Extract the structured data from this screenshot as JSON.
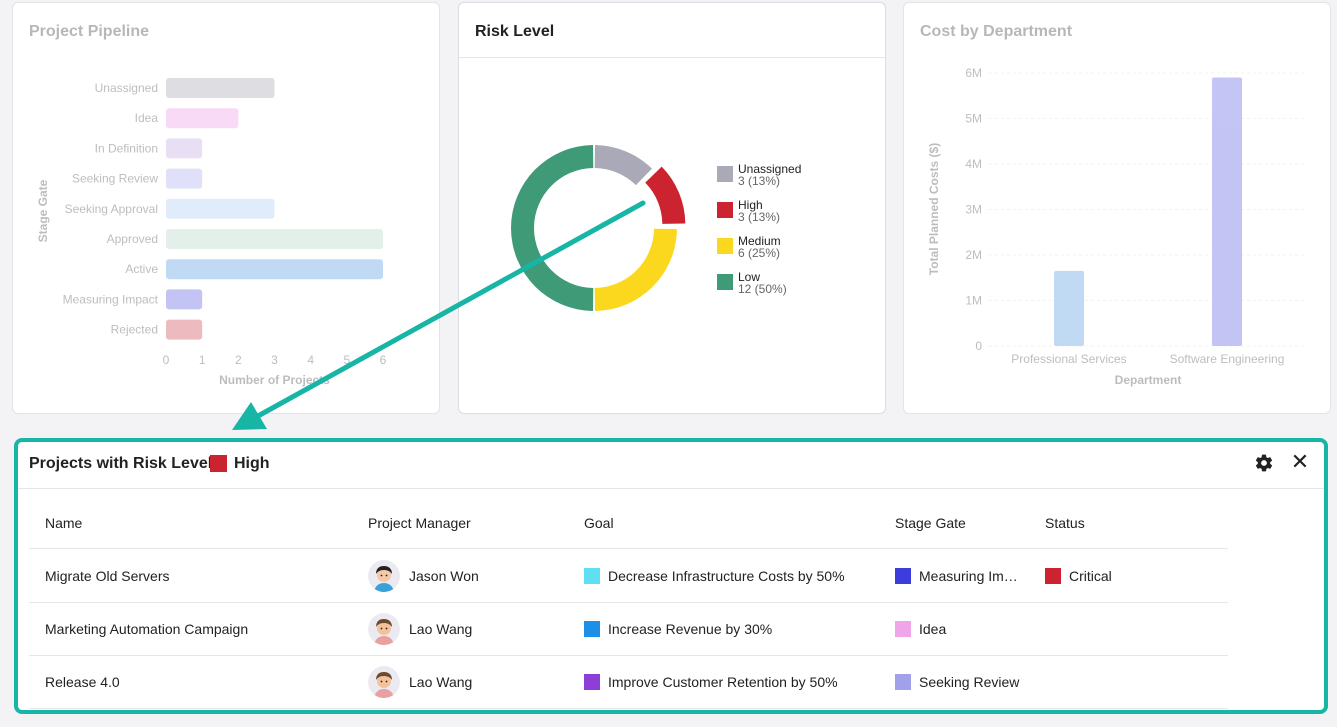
{
  "pipeline": {
    "title": "Project Pipeline",
    "chart_data": {
      "type": "bar",
      "orientation": "horizontal",
      "categories": [
        "Unassigned",
        "Idea",
        "In Definition",
        "Seeking Review",
        "Seeking Approval",
        "Approved",
        "Active",
        "Measuring Impact",
        "Rejected"
      ],
      "values": [
        3,
        2,
        1,
        1,
        3,
        6,
        6,
        1,
        1
      ],
      "colors": [
        "#9a9aa6",
        "#e989e3",
        "#b99ee3",
        "#a1a1ea",
        "#a4c6f0",
        "#a9d2c0",
        "#3d8fe0",
        "#4a4ae0",
        "#c62b3c"
      ],
      "xlabel": "Number of Projects",
      "ylabel": "Stage Gate",
      "xticks": [
        "0",
        "1",
        "2",
        "3",
        "4",
        "5",
        "6"
      ],
      "xlim": [
        0,
        6
      ]
    }
  },
  "risk": {
    "title": "Risk Level",
    "chart_data": {
      "type": "pie",
      "style": "donut",
      "legend_position": "right",
      "slices": [
        {
          "name": "Unassigned",
          "value": 3,
          "label": "3 (13%)",
          "color": "#a9a9b7"
        },
        {
          "name": "High",
          "value": 3,
          "label": "3 (13%)",
          "color": "#cc2330"
        },
        {
          "name": "Medium",
          "value": 6,
          "label": "6 (25%)",
          "color": "#fbd81e"
        },
        {
          "name": "Low",
          "value": 12,
          "label": "12 (50%)",
          "color": "#3f9a77"
        }
      ],
      "highlighted": "High"
    }
  },
  "cost": {
    "title": "Cost by Department",
    "chart_data": {
      "type": "bar",
      "categories": [
        "Professional Services",
        "Software Engineering"
      ],
      "values": [
        1650000,
        5900000
      ],
      "colors": [
        "#3d8fe0",
        "#4a4ae0"
      ],
      "xlabel": "Department",
      "ylabel": "Total Planned Costs ($)",
      "yticks": [
        "0",
        "1M",
        "2M",
        "3M",
        "4M",
        "5M",
        "6M"
      ],
      "ylim": [
        0,
        6000000
      ]
    }
  },
  "projects_panel": {
    "title": "Projects with Risk Level:",
    "level": "High",
    "level_color": "#cc2330",
    "gear_icon": "gear-icon",
    "close_label": "✕",
    "columns": [
      "Name",
      "Project Manager",
      "Goal",
      "Stage Gate",
      "Status"
    ],
    "rows": [
      {
        "name": "Migrate Old Servers",
        "manager": "Jason Won",
        "goal": "Decrease Infrastructure Costs by 50%",
        "goal_color": "#5ee0f0",
        "stage": "Measuring Impact",
        "stage_display": "Measuring Im…",
        "stage_color": "#3d3ddc",
        "status": "Critical",
        "status_color": "#cc2330"
      },
      {
        "name": "Marketing Automation Campaign",
        "manager": "Lao Wang",
        "goal": "Increase Revenue by 30%",
        "goal_color": "#1e8fe6",
        "stage": "Idea",
        "stage_display": "Idea",
        "stage_color": "#f0a5ea",
        "status": "",
        "status_color": ""
      },
      {
        "name": "Release 4.0",
        "manager": "Lao Wang",
        "goal": "Improve Customer Retention by 50%",
        "goal_color": "#8d3ed6",
        "stage": "Seeking Review",
        "stage_display": "Seeking Review",
        "stage_color": "#a1a1ea",
        "status": "",
        "status_color": ""
      }
    ]
  },
  "colors": {
    "accent": "#16b5a6"
  }
}
